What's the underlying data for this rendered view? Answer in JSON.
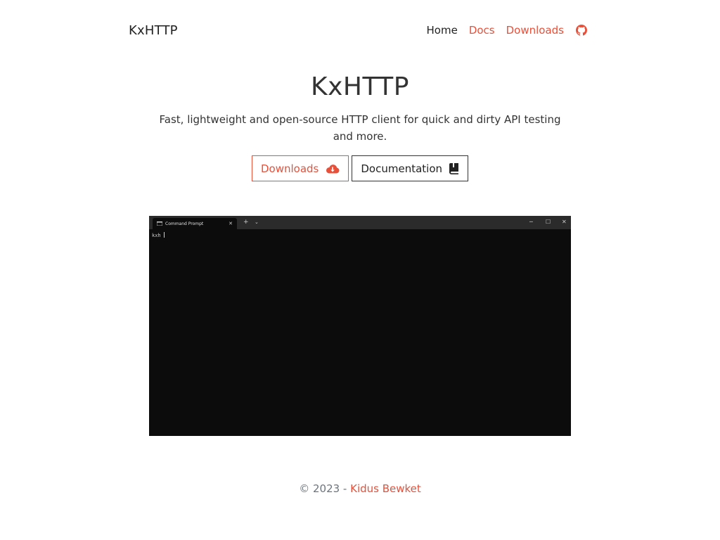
{
  "nav": {
    "brand": "KxHTTP",
    "links": [
      {
        "label": "Home",
        "active": true
      },
      {
        "label": "Docs",
        "active": false
      },
      {
        "label": "Downloads",
        "active": false
      }
    ],
    "github_icon": "github-icon"
  },
  "hero": {
    "title": "KxHTTP",
    "subtitle": "Fast, lightweight and open-source HTTP client for quick and dirty API testing and more.",
    "buttons": {
      "downloads": {
        "label": "Downloads",
        "icon": "cloud-download-icon"
      },
      "docs": {
        "label": "Documentation",
        "icon": "book-icon"
      }
    }
  },
  "terminal": {
    "tab_title": "Command Prompt",
    "tab_close": "✕",
    "new_tab": "+",
    "dropdown": "⌄",
    "minimize": "─",
    "maximize": "☐",
    "close": "✕",
    "prompt_text": "kxh"
  },
  "footer": {
    "prefix": "© 2023 - ",
    "author": "Kidus Bewket"
  },
  "colors": {
    "accent": "#e8503a",
    "text": "#333333",
    "footer_text": "#6c757d",
    "terminal_bg": "#0c0c0c",
    "terminal_titlebar": "#2b2b2b"
  }
}
